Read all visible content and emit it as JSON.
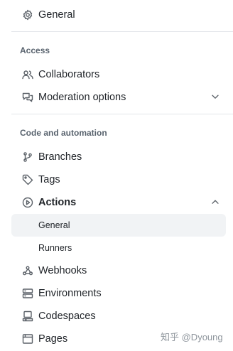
{
  "nav": {
    "general": {
      "label": "General",
      "icon": "gear-icon"
    },
    "sections": {
      "access": {
        "heading": "Access",
        "collaborators": {
          "label": "Collaborators",
          "icon": "people-icon"
        },
        "moderation": {
          "label": "Moderation options",
          "icon": "comment-discussion-icon",
          "expanded": false
        }
      },
      "code_automation": {
        "heading": "Code and automation",
        "branches": {
          "label": "Branches",
          "icon": "git-branch-icon"
        },
        "tags": {
          "label": "Tags",
          "icon": "tag-icon"
        },
        "actions": {
          "label": "Actions",
          "icon": "play-icon",
          "expanded": true,
          "children": [
            {
              "label": "General",
              "selected": true
            },
            {
              "label": "Runners",
              "selected": false
            }
          ]
        },
        "webhooks": {
          "label": "Webhooks",
          "icon": "webhook-icon"
        },
        "environments": {
          "label": "Environments",
          "icon": "server-icon"
        },
        "codespaces": {
          "label": "Codespaces",
          "icon": "codespaces-icon"
        },
        "pages": {
          "label": "Pages",
          "icon": "browser-icon"
        }
      }
    }
  },
  "watermark": "知乎 @Dyoung",
  "colors": {
    "active_indicator": "#0d6fd8",
    "selected_bg": "#f1f3f5",
    "text": "#1f2328",
    "muted": "#59636e"
  }
}
